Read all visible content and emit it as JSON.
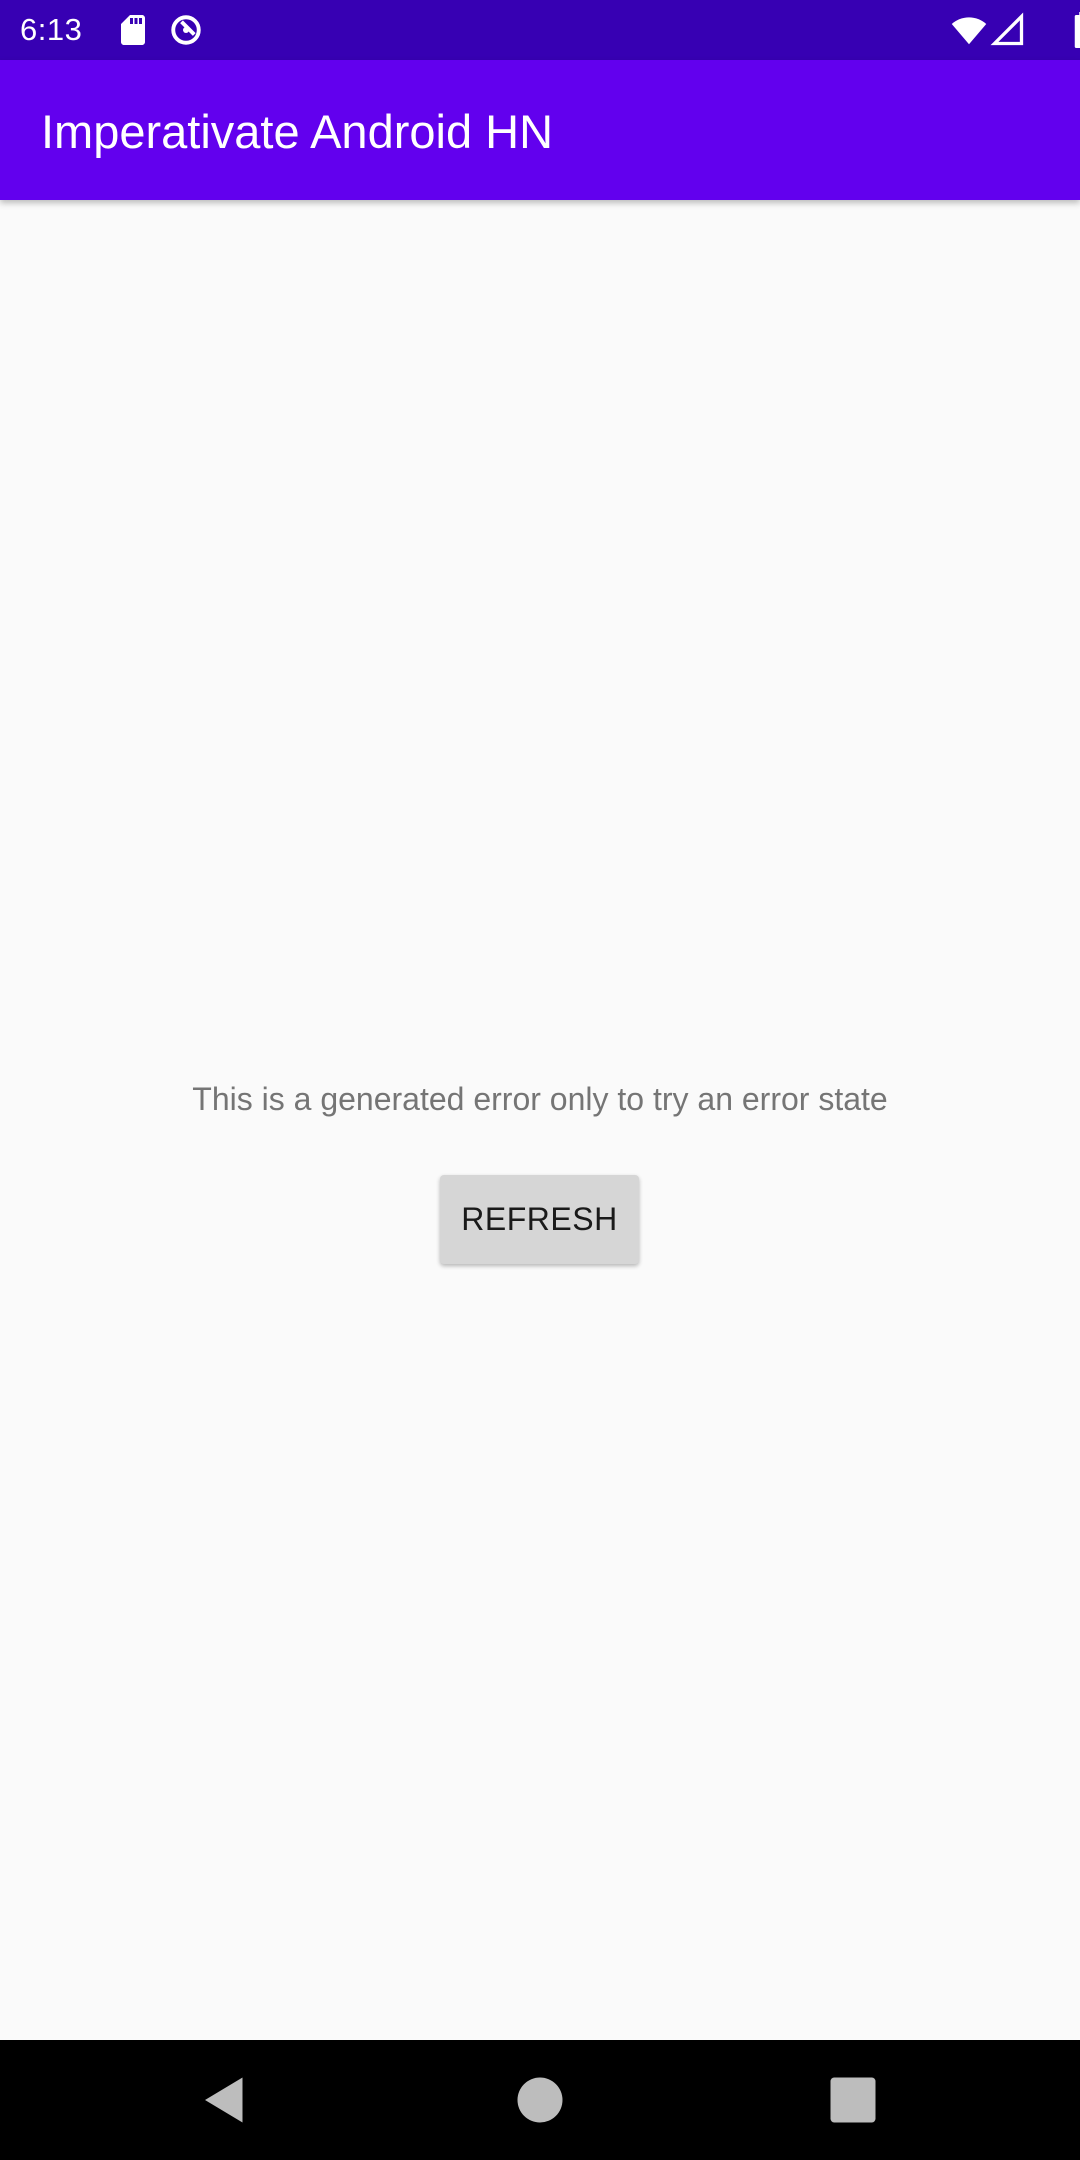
{
  "status_bar": {
    "time": "6:13",
    "icons": [
      "sd-card-icon",
      "data-saver-icon",
      "wifi-icon",
      "cell-signal-icon",
      "battery-icon"
    ]
  },
  "app_bar": {
    "title": "Imperativate Android HN",
    "color": "#6200ee"
  },
  "main": {
    "error_message": "This is a generated error only to try an error state",
    "refresh_label": "REFRESH"
  },
  "nav_bar": {
    "buttons": [
      "back-icon",
      "home-icon",
      "recents-icon"
    ]
  },
  "colors": {
    "status_bar": "#3700b3",
    "app_bar": "#6200ee",
    "background": "#fafafa",
    "button": "#d6d6d6"
  }
}
